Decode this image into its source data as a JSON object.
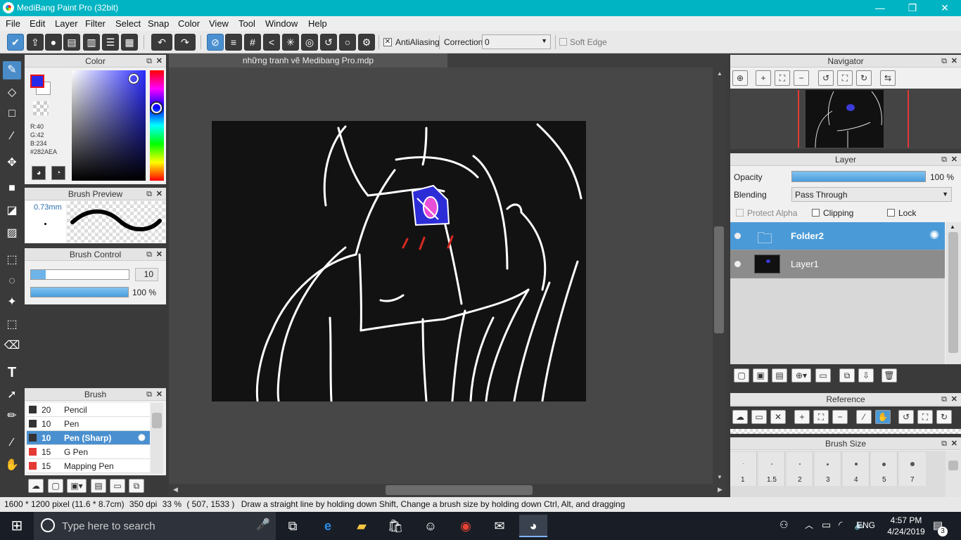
{
  "window": {
    "title": "MediBang Paint Pro (32bit)",
    "minimize_glyph": "—",
    "restore_glyph": "❐",
    "close_glyph": "✕"
  },
  "menu": [
    "File",
    "Edit",
    "Layer",
    "Filter",
    "Select",
    "Snap",
    "Color",
    "View",
    "Tool",
    "Window",
    "Help"
  ],
  "toolbar": {
    "antialiasing_label": "AntiAliasing",
    "antialiasing_checked": true,
    "correction_label": "Correction",
    "correction_value": "0",
    "soft_edge_label": "Soft Edge",
    "soft_edge_checked": false
  },
  "color_panel": {
    "title": "Color",
    "rgb_r": "R:40",
    "rgb_g": "G:42",
    "rgb_b": "B:234",
    "hex": "#282AEA",
    "color_hex": "#282AEA"
  },
  "brush_preview": {
    "title": "Brush Preview",
    "size_text": "0.73mm"
  },
  "brush_control": {
    "title": "Brush Control",
    "size_value": "10",
    "opacity_value": "100 %",
    "size_fraction": 0.15,
    "opacity_fraction": 1.0
  },
  "brush_panel": {
    "title": "Brush",
    "items": [
      {
        "size": "20",
        "name": "Pencil",
        "color": "#333333",
        "selected": false
      },
      {
        "size": "10",
        "name": "Pen",
        "color": "#333333",
        "selected": false
      },
      {
        "size": "10",
        "name": "Pen (Sharp)",
        "color": "#333333",
        "selected": true
      },
      {
        "size": "15",
        "name": "G Pen",
        "color": "#e53935",
        "selected": false
      },
      {
        "size": "15",
        "name": "Mapping Pen",
        "color": "#e53935",
        "selected": false
      }
    ]
  },
  "document": {
    "tab_title": "những tranh vẽ Medibang Pro.mdp"
  },
  "navigator": {
    "title": "Navigator"
  },
  "layer_panel": {
    "title": "Layer",
    "opacity_label": "Opacity",
    "opacity_value": "100 %",
    "opacity_fraction": 1.0,
    "blending_label": "Blending",
    "blending_value": "Pass Through",
    "protect_alpha_label": "Protect Alpha",
    "clipping_label": "Clipping",
    "lock_label": "Lock",
    "layers": [
      {
        "name": "Folder2",
        "type": "folder",
        "selected": true
      },
      {
        "name": "Layer1",
        "type": "layer",
        "selected": false
      }
    ]
  },
  "reference_panel": {
    "title": "Reference"
  },
  "brush_size_panel": {
    "title": "Brush Size",
    "sizes": [
      "1",
      "1.5",
      "2",
      "3",
      "4",
      "5",
      "7"
    ]
  },
  "status": {
    "dimensions": "1600 * 1200 pixel",
    "physical": "(11.6 * 8.7cm)",
    "dpi": "350 dpi",
    "zoom": "33 %",
    "coords": "( 507, 1533 )",
    "hint": "Draw a straight line by holding down Shift, Change a brush size by holding down Ctrl, Alt, and dragging"
  },
  "taskbar": {
    "search_placeholder": "Type here to search",
    "language": "ENG",
    "time": "4:57 PM",
    "date": "4/24/2019",
    "notification_count": "3"
  }
}
